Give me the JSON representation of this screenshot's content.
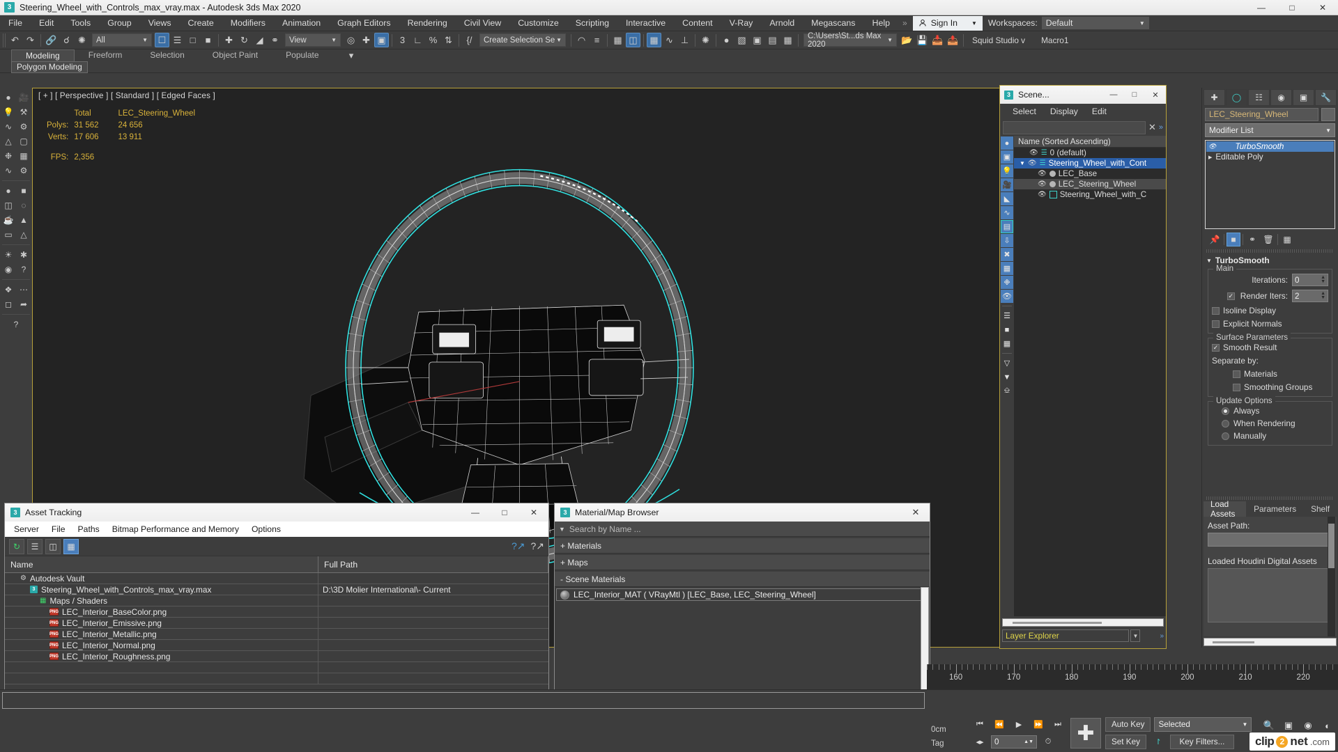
{
  "window": {
    "title": "Steering_Wheel_with_Controls_max_vray.max - Autodesk 3ds Max 2020",
    "logo": "3",
    "minimize": "—",
    "maximize": "□",
    "close": "✕"
  },
  "menubar": {
    "items": [
      "File",
      "Edit",
      "Tools",
      "Group",
      "Views",
      "Create",
      "Modifiers",
      "Animation",
      "Graph Editors",
      "Rendering",
      "Civil View",
      "Customize",
      "Scripting",
      "Interactive",
      "Content",
      "V-Ray",
      "Arnold",
      "Megascans",
      "Help"
    ],
    "overflow": "»",
    "signin": "Sign In",
    "workspaces_label": "Workspaces:",
    "workspaces_value": "Default"
  },
  "toolbar": {
    "selection_filter": "All",
    "ref_coord": "View",
    "selection_set": "Create Selection Se",
    "project_path": "C:\\Users\\St...ds Max 2020"
  },
  "subtoolbar": {
    "studio": "Squid Studio v",
    "macro": "Macro1"
  },
  "ribbon": {
    "tabs": [
      "Modeling",
      "Freeform",
      "Selection",
      "Object Paint",
      "Populate"
    ],
    "active_tab": "Modeling",
    "panel": "Polygon Modeling"
  },
  "viewport": {
    "label": "[ + ] [ Perspective ] [ Standard ] [ Edged Faces ]",
    "stats": {
      "col_total": "Total",
      "col_object": "LEC_Steering_Wheel",
      "polys_label": "Polys:",
      "polys_total": "31 562",
      "polys_obj": "24 656",
      "verts_label": "Verts:",
      "verts_total": "17 606",
      "verts_obj": "13 911",
      "fps_label": "FPS:",
      "fps_value": "2,356"
    }
  },
  "scene_explorer": {
    "title": "Scene...",
    "logo": "3",
    "minimize": "—",
    "maximize": "□",
    "close": "✕",
    "menu": [
      "Select",
      "Display",
      "Edit"
    ],
    "search_value": "",
    "clear": "✕",
    "overflow": "»",
    "column_header": "Name (Sorted Ascending)",
    "rows": [
      {
        "label": "0 (default)",
        "type": "layer",
        "indent": 1,
        "state": "normal"
      },
      {
        "label": "Steering_Wheel_with_Cont",
        "type": "layer",
        "indent": 1,
        "state": "selected"
      },
      {
        "label": "LEC_Base",
        "type": "object",
        "indent": 2,
        "state": "normal"
      },
      {
        "label": "LEC_Steering_Wheel",
        "type": "object",
        "indent": 2,
        "state": "highlight"
      },
      {
        "label": "Steering_Wheel_with_C",
        "type": "group",
        "indent": 2,
        "state": "normal"
      }
    ],
    "layer_explorer_label": "Layer Explorer"
  },
  "command_panel": {
    "tabs": [
      "create",
      "modify",
      "hierarchy",
      "motion",
      "display",
      "utilities"
    ],
    "active_tab": "modify",
    "object_name": "LEC_Steering_Wheel",
    "modifier_list": "Modifier List",
    "stack": [
      {
        "label": "TurboSmooth",
        "selected": true
      },
      {
        "label": "Editable Poly",
        "selected": false
      }
    ],
    "rollout_title": "TurboSmooth",
    "main_group": "Main",
    "iterations_label": "Iterations:",
    "iterations_value": "0",
    "render_iters_label": "Render Iters:",
    "render_iters_value": "2",
    "render_iters_checked": true,
    "isoline_label": "Isoline Display",
    "isoline_checked": false,
    "explicit_label": "Explicit Normals",
    "explicit_checked": false,
    "surface_group": "Surface Parameters",
    "smooth_result_label": "Smooth Result",
    "smooth_result_checked": true,
    "separate_label": "Separate by:",
    "materials_label": "Materials",
    "materials_checked": false,
    "smoothing_groups_label": "Smoothing Groups",
    "smoothing_groups_checked": false,
    "update_group": "Update Options",
    "update_options": [
      "Always",
      "When Rendering",
      "Manually"
    ],
    "update_selected": "Always",
    "lower_tabs": [
      "Load Assets",
      "Parameters",
      "Shelf"
    ],
    "lower_active": "Load Assets",
    "asset_path_label": "Asset Path:",
    "asset_path_value": "",
    "loaded_hda_label": "Loaded Houdini Digital Assets"
  },
  "asset_tracking": {
    "title": "Asset Tracking",
    "logo": "3",
    "minimize": "—",
    "maximize": "□",
    "close": "✕",
    "menu": [
      "Server",
      "File",
      "Paths",
      "Bitmap Performance and Memory",
      "Options"
    ],
    "columns": [
      "Name",
      "Full Path"
    ],
    "rows": [
      {
        "name": "Autodesk Vault",
        "path": "",
        "indent": 1,
        "icon": "vault"
      },
      {
        "name": "Steering_Wheel_with_Controls_max_vray.max",
        "path": "D:\\3D Molier International\\- Current",
        "indent": 2,
        "icon": "max"
      },
      {
        "name": "Maps / Shaders",
        "path": "",
        "indent": 3,
        "icon": "maps"
      },
      {
        "name": "LEC_Interior_BaseColor.png",
        "path": "",
        "indent": 4,
        "icon": "png"
      },
      {
        "name": "LEC_Interior_Emissive.png",
        "path": "",
        "indent": 4,
        "icon": "png"
      },
      {
        "name": "LEC_Interior_Metallic.png",
        "path": "",
        "indent": 4,
        "icon": "png"
      },
      {
        "name": "LEC_Interior_Normal.png",
        "path": "",
        "indent": 4,
        "icon": "png"
      },
      {
        "name": "LEC_Interior_Roughness.png",
        "path": "",
        "indent": 4,
        "icon": "png"
      },
      {
        "name": "",
        "path": "",
        "indent": 0,
        "icon": "none"
      },
      {
        "name": "",
        "path": "",
        "indent": 0,
        "icon": "none"
      }
    ]
  },
  "material_browser": {
    "title": "Material/Map Browser",
    "logo": "3",
    "close": "✕",
    "search_placeholder": "Search by Name ...",
    "groups": [
      "+ Materials",
      "+ Maps",
      "- Scene Materials"
    ],
    "scene_material": "LEC_Interior_MAT  ( VRayMtl )  [LEC_Base, LEC_Steering_Wheel]"
  },
  "timeline": {
    "labels": [
      "160",
      "170",
      "180",
      "190",
      "200",
      "210",
      "220"
    ],
    "start": 155,
    "end": 226
  },
  "statusbar": {
    "coord_x": "0cm",
    "tag": "Tag",
    "frame_value": "0",
    "auto_key": "Auto Key",
    "set_key": "Set Key",
    "key_filters": "Key Filters...",
    "selection_mode": "Selected",
    "transport": [
      "⏮",
      "⏪",
      "▶",
      "⏩",
      "⏭"
    ],
    "add_key": "+"
  },
  "watermark": {
    "c": "clip",
    "two": "2",
    "net": "net",
    "com": ".com"
  }
}
